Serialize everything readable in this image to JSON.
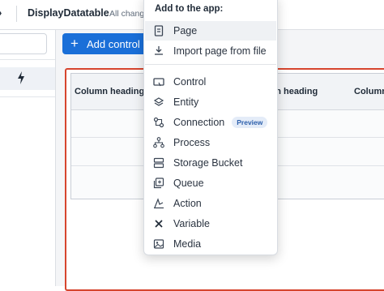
{
  "header": {
    "back_glyph": "›",
    "app_title": "DisplayDatatable",
    "save_status": "All changes"
  },
  "toolbar": {
    "add_control_label": "Add control"
  },
  "datatable": {
    "columns": [
      "Column heading",
      "Column heading",
      "Column"
    ]
  },
  "menu": {
    "header": "Add to the app:",
    "items": [
      {
        "label": "Page",
        "icon": "page-icon"
      },
      {
        "label": "Import page from file",
        "icon": "import-icon"
      },
      {
        "label": "Control",
        "icon": "control-icon"
      },
      {
        "label": "Entity",
        "icon": "entity-icon"
      },
      {
        "label": "Connection",
        "icon": "connection-icon",
        "badge": "Preview"
      },
      {
        "label": "Process",
        "icon": "process-icon"
      },
      {
        "label": "Storage Bucket",
        "icon": "storage-bucket-icon"
      },
      {
        "label": "Queue",
        "icon": "queue-icon"
      },
      {
        "label": "Action",
        "icon": "action-icon"
      },
      {
        "label": "Variable",
        "icon": "variable-icon"
      },
      {
        "label": "Media",
        "icon": "media-icon"
      }
    ]
  },
  "colors": {
    "accent": "#1a6fd8",
    "selection": "#d6452e",
    "highlight": "#f6f300"
  }
}
